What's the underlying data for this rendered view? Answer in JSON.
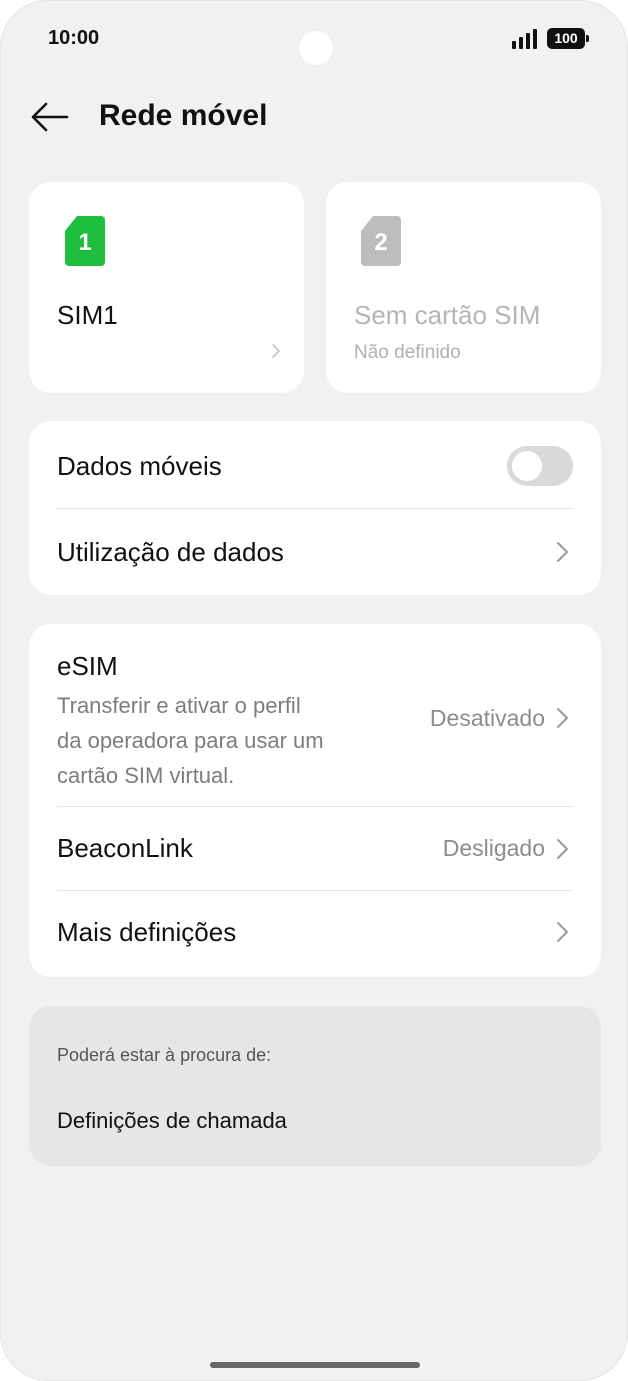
{
  "status_bar": {
    "time": "10:00",
    "battery": "100"
  },
  "header": {
    "title": "Rede móvel"
  },
  "sim_cards": [
    {
      "number": "1",
      "title": "SIM1",
      "subtitle": "",
      "color": "#1fbe3c"
    },
    {
      "number": "2",
      "title": "Sem cartão SIM",
      "subtitle": "Não definido",
      "color": "#bdbdbd"
    }
  ],
  "data_section": {
    "mobile_data": {
      "label": "Dados móveis",
      "enabled": false
    },
    "data_usage": {
      "label": "Utilização de dados"
    }
  },
  "more_section": {
    "esim": {
      "label": "eSIM",
      "desc_line1": "Transferir e ativar o perfil",
      "desc_line2": "da operadora para usar um",
      "desc_line3": "cartão SIM virtual.",
      "value": "Desativado"
    },
    "beaconlink": {
      "label": "BeaconLink",
      "value": "Desligado"
    },
    "more_settings": {
      "label": "Mais definições"
    }
  },
  "suggestions": {
    "heading": "Poderá estar à procura de:",
    "item": "Definições de chamada"
  },
  "colors": {
    "accent": "#1fbe3c",
    "background": "#f1f1f3",
    "card": "#ffffff"
  }
}
